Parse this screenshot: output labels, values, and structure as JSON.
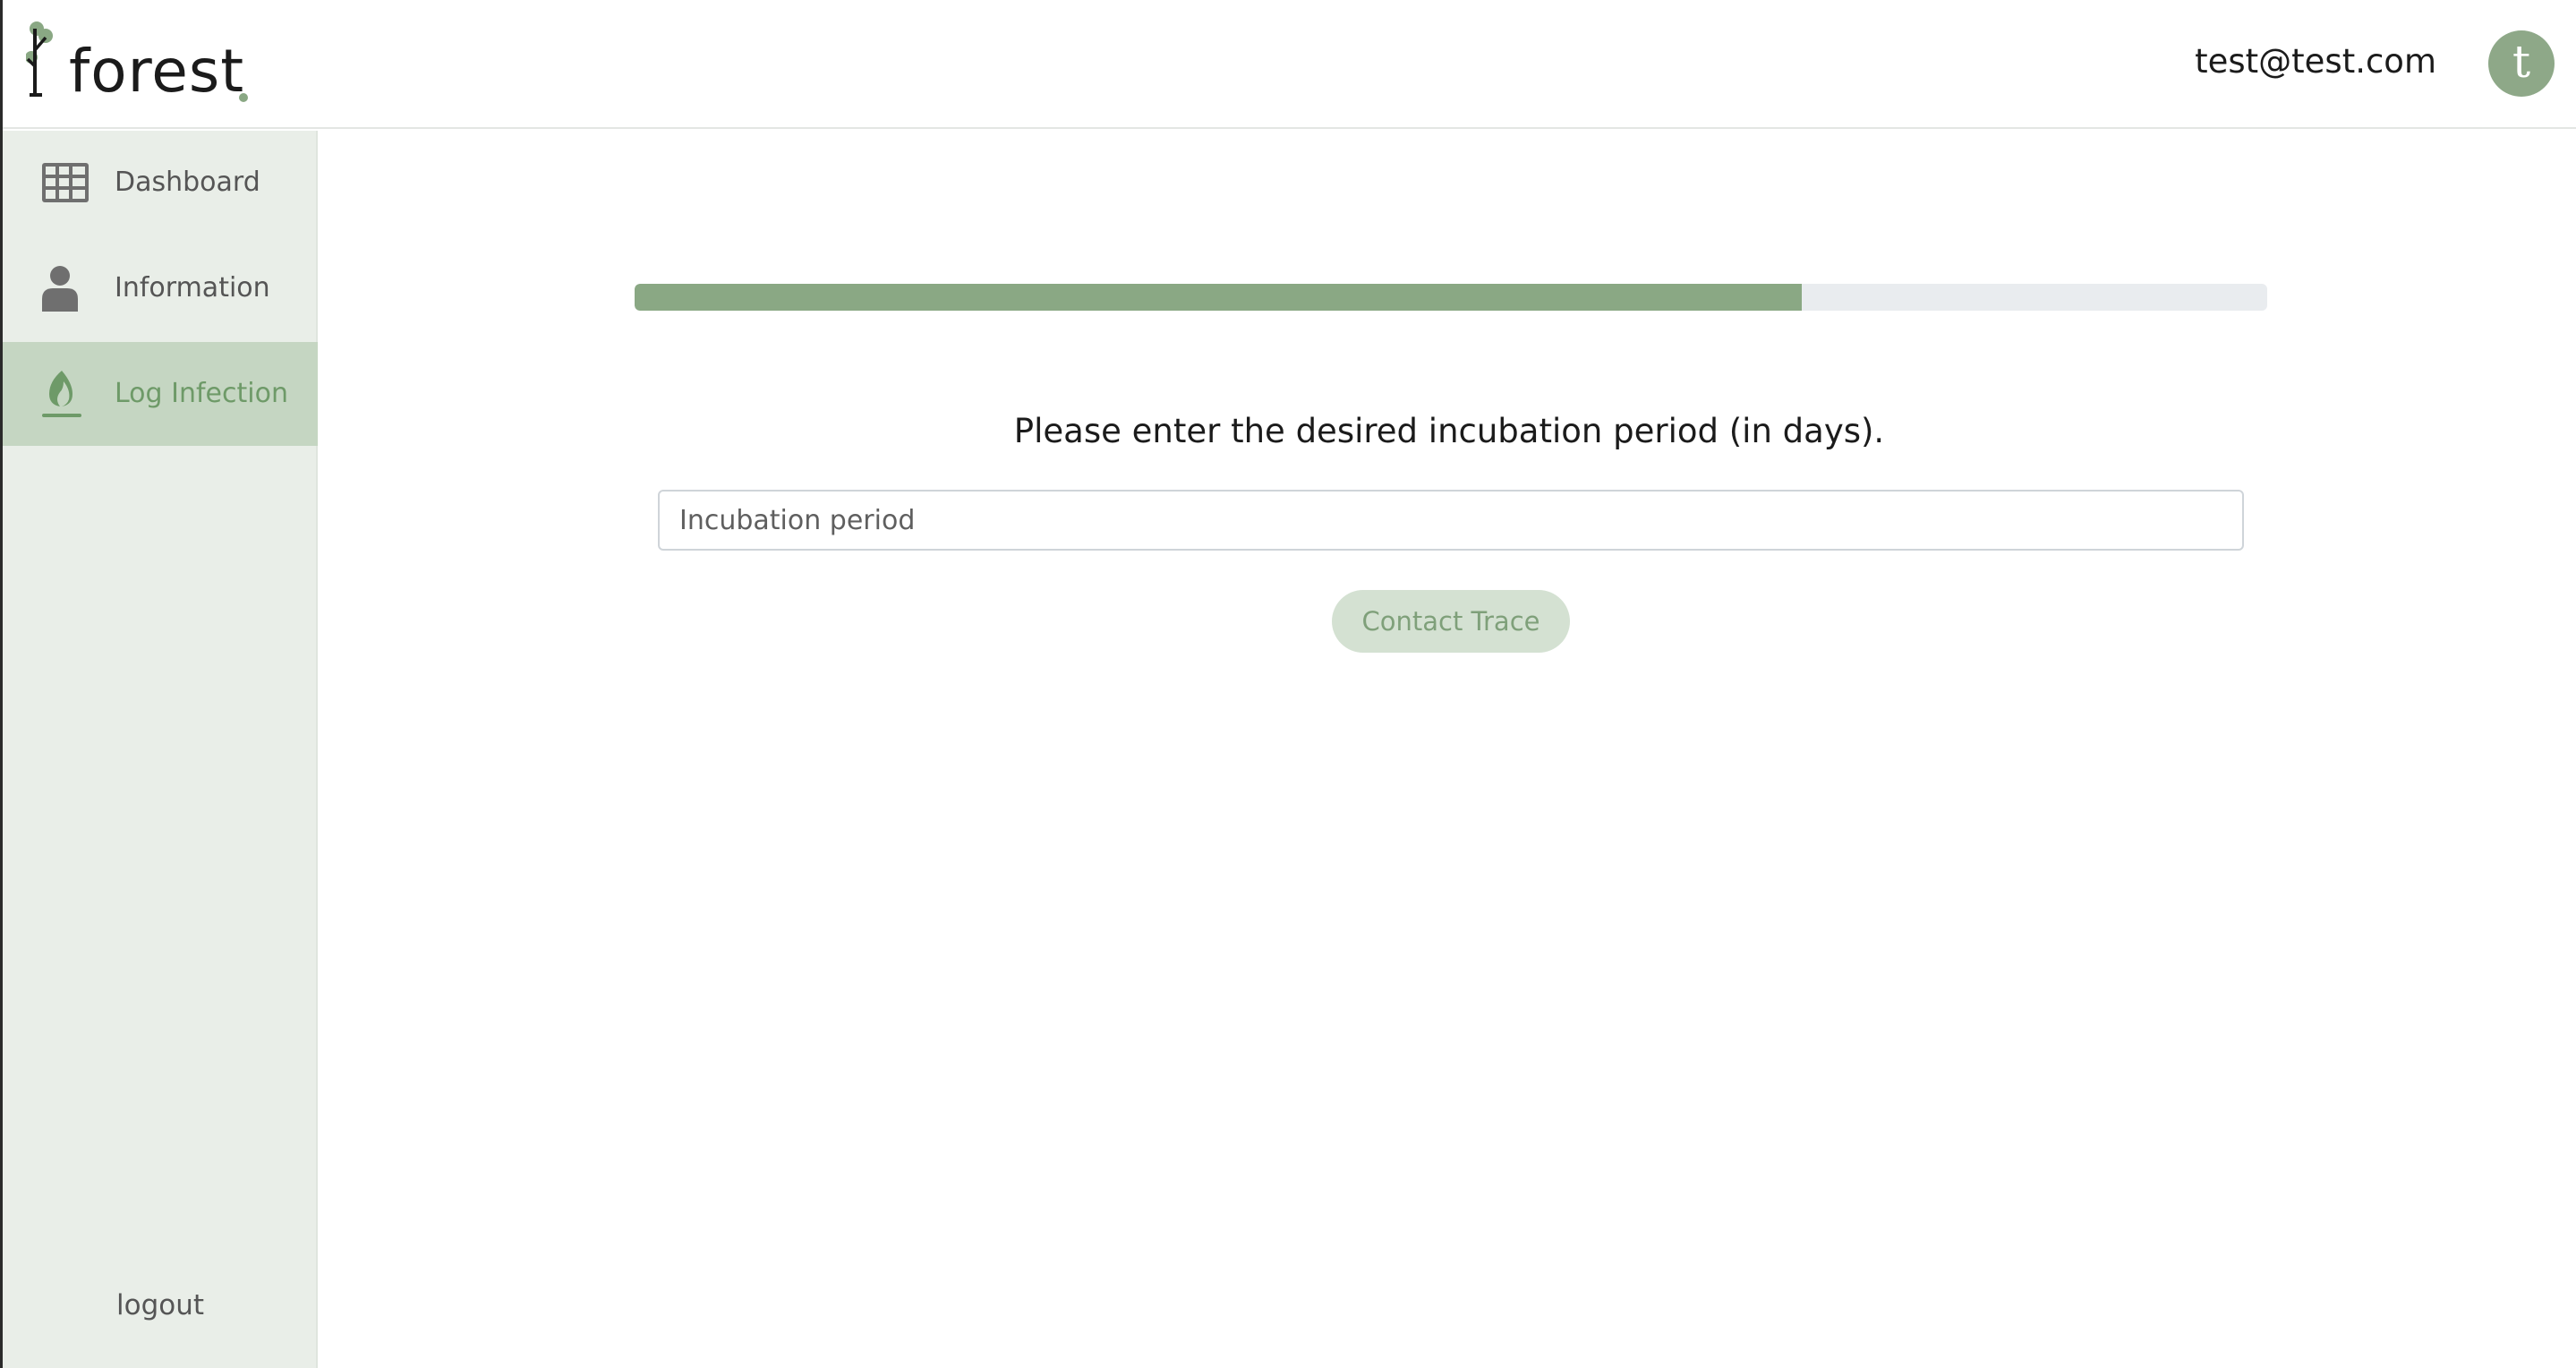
{
  "brand": {
    "name": "forest",
    "logo_icon": "tree-icon",
    "accent_color": "#8aa884"
  },
  "header": {
    "user_email": "test@test.com",
    "avatar_letter": "t"
  },
  "sidebar": {
    "items": [
      {
        "label": "Dashboard",
        "icon": "grid-icon",
        "active": false
      },
      {
        "label": "Information",
        "icon": "person-icon",
        "active": false
      },
      {
        "label": "Log Infection",
        "icon": "flame-icon",
        "active": true
      }
    ],
    "logout_label": "logout"
  },
  "main": {
    "progress_fraction": 0.715,
    "prompt": "Please enter the desired incubation period (in days).",
    "input_value": "",
    "input_placeholder": "Incubation period",
    "button_label": "Contact Trace"
  }
}
